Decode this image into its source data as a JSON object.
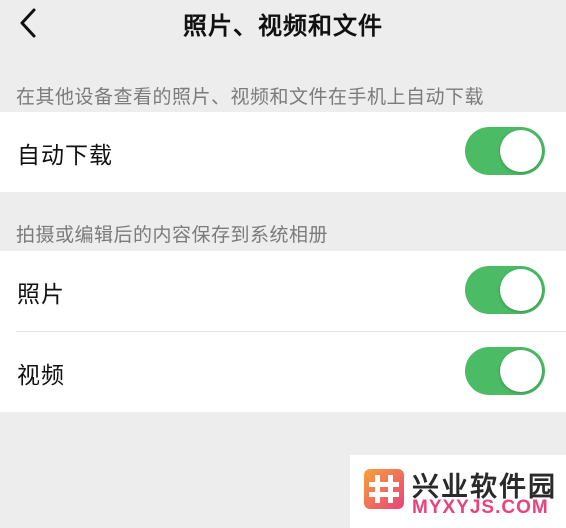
{
  "nav": {
    "title": "照片、视频和文件",
    "back_icon": "chevron-left-icon"
  },
  "sections": [
    {
      "caption": "在其他设备查看的照片、视频和文件在手机上自动下载",
      "items": [
        {
          "label": "自动下载",
          "enabled": true
        }
      ]
    },
    {
      "caption": "拍摄或编辑后的内容保存到系统相册",
      "items": [
        {
          "label": "照片",
          "enabled": true
        },
        {
          "label": "视频",
          "enabled": true
        }
      ]
    }
  ],
  "colors": {
    "toggle_on": "#4cbb65",
    "background": "#ededed",
    "watermark_accent": "#e8437a"
  },
  "watermark": {
    "name": "兴业软件园",
    "domain": "MYXYJS.COM",
    "logo_icon": "hash-logo-icon"
  }
}
